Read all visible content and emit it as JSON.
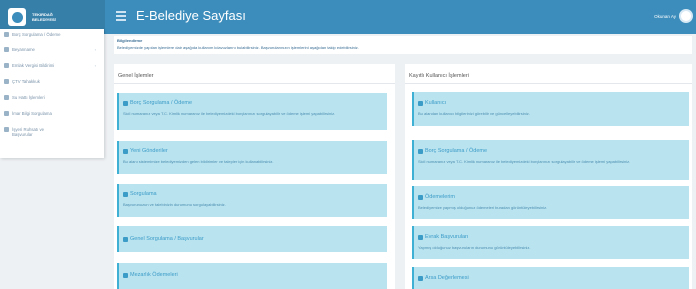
{
  "header": {
    "logo_line1": "TEKIRDAĞ",
    "logo_line2": "BELEDİYESİ",
    "app_title": "E-Belediye Sayfası",
    "user_name": "Okunan Ay"
  },
  "sidebar": {
    "items": [
      {
        "label": "Borç Sorgulama / Ödeme",
        "icon": "wallet-icon"
      },
      {
        "label": "Beyanname",
        "icon": "pencil-icon",
        "caret": "‹"
      },
      {
        "label": "Emlak Vergisi Bildirimi",
        "icon": "list-icon",
        "caret": "‹"
      },
      {
        "label": "ÇTV Tahakkuk",
        "icon": "plus-icon"
      },
      {
        "label": "Su Hattı İşlemleri",
        "icon": "water-icon"
      },
      {
        "label": "İmar Bilgi Sorgulama",
        "icon": "building-icon"
      },
      {
        "label": "İşyeri Ruhsatı ve",
        "label2": "Başvurular",
        "icon": "document-icon"
      }
    ]
  },
  "notice": {
    "title": "Bilgilendirme",
    "text": "Belediyemizde yapılan işlemlere dair aşağıda kullanım kılavuzlarını bulabilirsiniz. Başvurularınızın işlemlerini aşağıdan takip edebilirsiniz."
  },
  "left_panel": {
    "title": "Genel İşlemler",
    "cards": [
      {
        "title": "Borç Sorgulama / Ödeme",
        "icon": "credit-card-icon",
        "desc": "Sicil numaranız veya T.C. Kimlik numaranız ile belediyemizdeki borçlarınızı sorgulayabilir ve ödeme işlemi yapabilirsiniz."
      },
      {
        "title": "Yeni Gönderiler",
        "icon": "wrench-icon",
        "desc": "Bu alanı sistemimize belediyemizden gelen bildirimler ve talepler için kullanabilirsiniz."
      },
      {
        "title": "Sorgulama",
        "icon": "info-icon",
        "desc": "Başvurunuzun ve talebinizin durumunu sorgulayabilirsiniz."
      },
      {
        "title": "Genel Sorgulama / Başvurular",
        "icon": "flag-icon",
        "desc": ""
      },
      {
        "title": "Mezarlık Ödemeleri",
        "icon": "receipt-icon",
        "desc": ""
      }
    ]
  },
  "right_panel": {
    "title": "Kayıtlı Kullanıcı İşlemleri",
    "cards": [
      {
        "title": "Kullanıcı",
        "icon": "user-icon",
        "desc": "Bu alandan kullanıcı bilgilerinizi görebilir ve güncelleyebilirsiniz."
      },
      {
        "title": "Borç Sorgulama / Ödeme",
        "icon": "credit-card-icon",
        "desc": "Sicil numaranız veya T.C. Kimlik numaranız ile belediyemizdeki borçlarınızı sorgulayabilir ve ödeme işlemi yapabilirsiniz."
      },
      {
        "title": "Ödemelerim",
        "icon": "list-icon",
        "desc": "Belediyemize yapmış olduğunuz ödemeleri buradan görüntüleyebilirsiniz."
      },
      {
        "title": "Evrak Başvuruları",
        "icon": "folder-icon",
        "desc": "Yapmış olduğunuz başvuruların durumunu görüntüleyebilirsiniz."
      },
      {
        "title": "Arsa Değerlemesi",
        "icon": "map-icon",
        "desc": ""
      }
    ]
  }
}
